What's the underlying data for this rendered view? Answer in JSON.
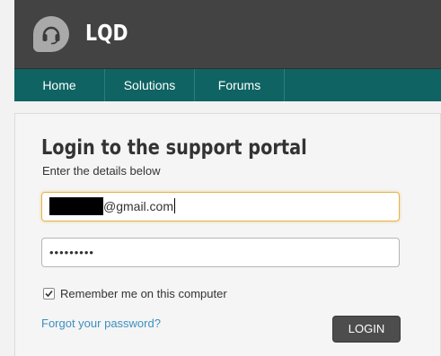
{
  "header": {
    "brand": "LQD",
    "logo_icon": "headset-icon"
  },
  "nav": {
    "items": [
      {
        "label": "Home"
      },
      {
        "label": "Solutions"
      },
      {
        "label": "Forums"
      }
    ]
  },
  "login": {
    "title": "Login to the support portal",
    "subtitle": "Enter the details below",
    "email_value_visible": "@gmail.com",
    "password_value": "•••••••••",
    "remember_label": "Remember me on this computer",
    "remember_checked": true,
    "forgot_link": "Forgot your password?",
    "login_button": "LOGIN"
  },
  "colors": {
    "header_bg": "#434343",
    "nav_bg": "#0f6363",
    "link": "#3d8fbf",
    "button_bg": "#4d4d4d",
    "focus_border": "#e6b44a"
  }
}
